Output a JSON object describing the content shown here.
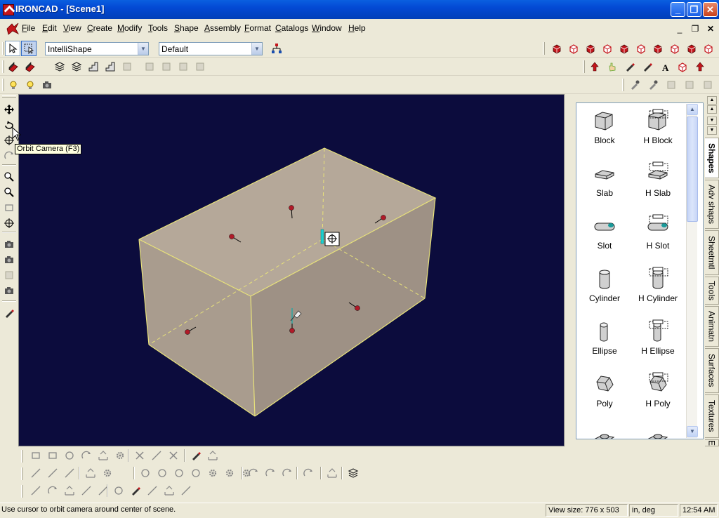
{
  "window": {
    "title": "IRONCAD - [Scene1]",
    "icon": "ironcad-logo-icon",
    "controls": [
      "minimize-icon",
      "maximize-icon",
      "close-icon"
    ]
  },
  "menu": {
    "items": [
      {
        "label": "File",
        "name": "menu-file"
      },
      {
        "label": "Edit",
        "name": "menu-edit"
      },
      {
        "label": "View",
        "name": "menu-view"
      },
      {
        "label": "Create",
        "name": "menu-create"
      },
      {
        "label": "Modify",
        "name": "menu-modify"
      },
      {
        "label": "Tools",
        "name": "menu-tools"
      },
      {
        "label": "Shape",
        "name": "menu-shape"
      },
      {
        "label": "Assembly",
        "name": "menu-assembly"
      },
      {
        "label": "Format",
        "name": "menu-format"
      },
      {
        "label": "Catalogs",
        "name": "menu-catalogs"
      },
      {
        "label": "Window",
        "name": "menu-window"
      },
      {
        "label": "Help",
        "name": "menu-help"
      }
    ],
    "doc_controls": [
      "_",
      "🗗",
      "X"
    ]
  },
  "toolbar": {
    "selection_filter": "IntelliShape",
    "style_select": "Default"
  },
  "viewport": {
    "background": "#0c0c3d",
    "tooltip": "Orbit Camera (F3)",
    "block_color": "#b2a496",
    "edge_color": "#e8e27a",
    "anchor_color": "#b01a28"
  },
  "catalog": {
    "items": [
      {
        "label": "Block",
        "name": "catalog-item-block",
        "icon": "block-icon"
      },
      {
        "label": "H Block",
        "name": "catalog-item-h-block",
        "icon": "h-block-icon"
      },
      {
        "label": "Slab",
        "name": "catalog-item-slab",
        "icon": "slab-icon"
      },
      {
        "label": "H Slab",
        "name": "catalog-item-h-slab",
        "icon": "h-slab-icon"
      },
      {
        "label": "Slot",
        "name": "catalog-item-slot",
        "icon": "slot-icon"
      },
      {
        "label": "H Slot",
        "name": "catalog-item-h-slot",
        "icon": "h-slot-icon"
      },
      {
        "label": "Cylinder",
        "name": "catalog-item-cylinder",
        "icon": "cylinder-icon"
      },
      {
        "label": "H Cylinder",
        "name": "catalog-item-h-cylinder",
        "icon": "h-cylinder-icon"
      },
      {
        "label": "Ellipse",
        "name": "catalog-item-ellipse",
        "icon": "ellipse-icon"
      },
      {
        "label": "H Ellipse",
        "name": "catalog-item-h-ellipse",
        "icon": "h-ellipse-icon"
      },
      {
        "label": "Poly",
        "name": "catalog-item-poly",
        "icon": "poly-icon"
      },
      {
        "label": "H Poly",
        "name": "catalog-item-h-poly",
        "icon": "h-poly-icon"
      }
    ],
    "tabs": [
      {
        "label": "Shapes",
        "name": "tab-shapes"
      },
      {
        "label": "Adv shaps",
        "name": "tab-adv-shaps"
      },
      {
        "label": "Sheetmtl",
        "name": "tab-sheetmtl"
      },
      {
        "label": "Tools",
        "name": "tab-tools"
      },
      {
        "label": "Animatn",
        "name": "tab-animatn"
      },
      {
        "label": "Surfaces",
        "name": "tab-surfaces"
      },
      {
        "label": "Textures",
        "name": "tab-textures"
      },
      {
        "label": "E",
        "name": "tab-e"
      }
    ]
  },
  "status": {
    "message": "Use cursor to orbit camera around center of scene.",
    "view_size_label": "View size:",
    "view_size": "776 x 503",
    "units": "in, deg",
    "time": "12:54 AM"
  }
}
